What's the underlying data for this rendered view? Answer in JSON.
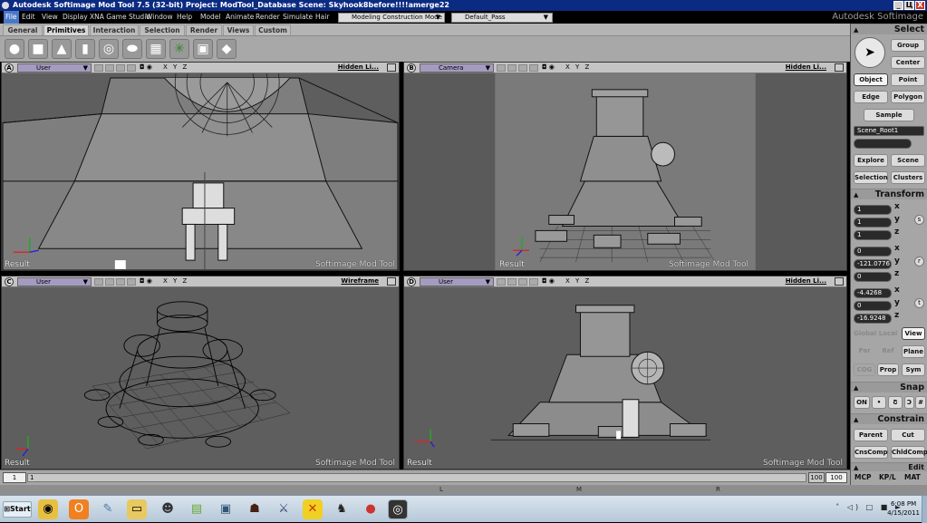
{
  "window": {
    "title": "Autodesk Softimage Mod Tool 7.5 (32-bit)   Project: ModTool_Database   Scene: Skyhook8before!!!!amerge22",
    "buttons": [
      "_",
      "Ц",
      "X"
    ]
  },
  "menubar": {
    "items": [
      "File",
      "Edit",
      "View",
      "Display",
      "XNA Game Studio",
      "Window",
      "Help",
      "Model",
      "Animate",
      "Render",
      "Simulate",
      "Hair"
    ],
    "mode": "Modeling Construction Mode",
    "pass": "Default_Pass",
    "brand": "Autodesk Softimage"
  },
  "tabs": [
    "General",
    "Primitives",
    "Interaction",
    "Selection",
    "Render",
    "Views",
    "Custom"
  ],
  "active_tab": "Primitives",
  "tools": [
    "sphere",
    "cube",
    "cone",
    "cylinder",
    "torus",
    "disc",
    "grid",
    "null",
    "model",
    "material"
  ],
  "viewports": [
    {
      "letter": "A",
      "camera": "User",
      "axes": "X Y Z",
      "shading": "Hidden Li...",
      "result": "Result",
      "watermark": "Softimage  Mod  Tool"
    },
    {
      "letter": "B",
      "camera": "Camera",
      "axes": "X Y Z",
      "shading": "Hidden Li...",
      "result": "Result",
      "watermark": "Softimage  Mod  Tool"
    },
    {
      "letter": "C",
      "camera": "User",
      "axes": "X Y Z",
      "shading": "Wireframe",
      "result": "Result",
      "watermark": "Softimage  Mod  Tool"
    },
    {
      "letter": "D",
      "camera": "User",
      "axes": "X Y Z",
      "shading": "Hidden Li...",
      "result": "Result",
      "watermark": "Softimage  Mod  Tool"
    }
  ],
  "right_panel": {
    "select_header": "Select",
    "group": "Group",
    "center": "Center",
    "object": "Object",
    "point": "Point",
    "edge": "Edge",
    "polygon": "Polygon",
    "sample": "Sample",
    "scene_root": "Scene_Root1",
    "explore": "Explore",
    "scene": "Scene",
    "selection": "Selection",
    "clusters": "Clusters",
    "transform_header": "Transform",
    "scale": [
      "1",
      "1",
      "1"
    ],
    "rotation": [
      "0",
      "-121.0776",
      "0"
    ],
    "translation": [
      "-4.4268",
      "0",
      "-16.9248"
    ],
    "axis_labels": [
      "x",
      "y",
      "z"
    ],
    "srt": [
      "s",
      "r",
      "t"
    ],
    "global": "Global",
    "local": "Local",
    "view": "View",
    "par": "Par",
    "ref": "Ref",
    "plane": "Plane",
    "cog": "COG",
    "prop": "Prop",
    "sym": "Sym",
    "snap_header": "Snap",
    "on": "ON",
    "constrain_header": "Constrain",
    "parent": "Parent",
    "cut": "Cut",
    "cnscomp": "CnsComp",
    "chldcomp": "ChldComp",
    "edit_header": "Edit"
  },
  "timeline": {
    "start": "1",
    "current": "1",
    "end_field": "100",
    "end": "100"
  },
  "mcp": {
    "a": "MCP",
    "b": "KP/L",
    "c": "MAT"
  },
  "panel_labels": [
    "L",
    "M",
    "R"
  ],
  "taskbar": {
    "start": "Start",
    "apps": [
      "chrome",
      "outlook",
      "tools",
      "folder",
      "character",
      "book",
      "window",
      "shadow",
      "sword",
      "xna",
      "clone",
      "ball",
      "softimage"
    ],
    "tray": "˄ ◁) □ ■ ►",
    "time": "6:08 PM",
    "date": "4/15/2011"
  }
}
